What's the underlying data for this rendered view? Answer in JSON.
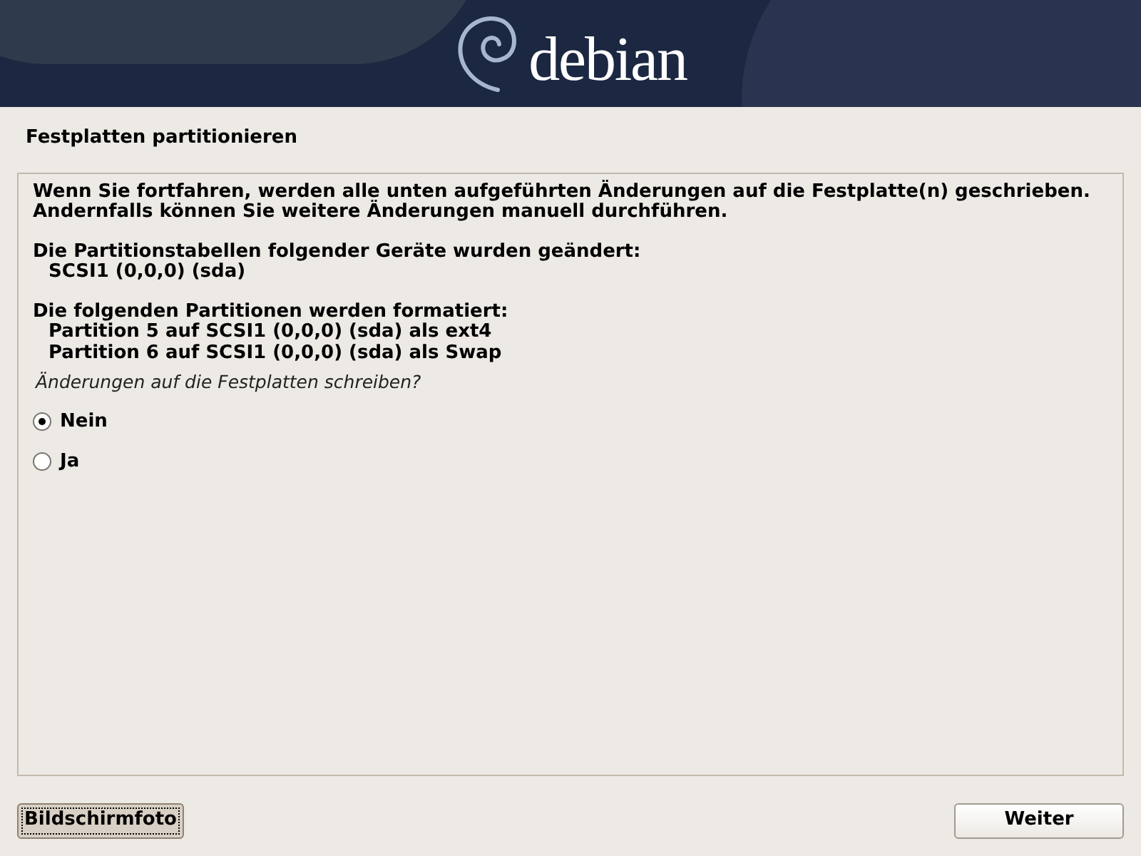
{
  "banner": {
    "logo_text": "debian"
  },
  "title": "Festplatten partitionieren",
  "message": [
    {
      "kind": "text",
      "text": "Wenn Sie fortfahren, werden alle unten aufgeführten Änderungen auf die Festplatte(n) geschrieben."
    },
    {
      "kind": "text",
      "text": "Andernfalls können Sie weitere Änderungen manuell durchführen."
    },
    {
      "kind": "gap"
    },
    {
      "kind": "text",
      "text": "Die Partitionstabellen folgender Geräte wurden geändert:"
    },
    {
      "kind": "item",
      "text": "SCSI1 (0,0,0) (sda)"
    },
    {
      "kind": "gap"
    },
    {
      "kind": "text",
      "text": "Die folgenden Partitionen werden formatiert:"
    },
    {
      "kind": "item",
      "text": "Partition 5 auf SCSI1 (0,0,0) (sda) als ext4"
    },
    {
      "kind": "item",
      "text": "Partition 6 auf SCSI1 (0,0,0) (sda) als Swap"
    }
  ],
  "question": "Änderungen auf die Festplatten schreiben?",
  "options": [
    {
      "label": "Nein",
      "selected": true
    },
    {
      "label": "Ja",
      "selected": false
    }
  ],
  "buttons": [
    {
      "label": "Bildschirmfoto",
      "focused": true
    },
    {
      "label": "Weiter",
      "focused": false
    }
  ]
}
